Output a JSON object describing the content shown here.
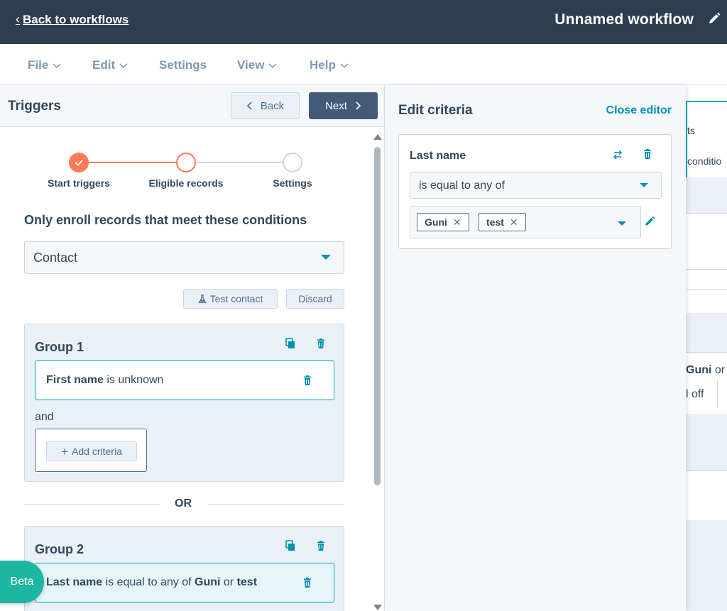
{
  "topbar": {
    "back_label": "Back to workflows",
    "title": "Unnamed workflow"
  },
  "menu": {
    "items": [
      {
        "label": "File",
        "has_caret": true
      },
      {
        "label": "Edit",
        "has_caret": true
      },
      {
        "label": "Settings",
        "has_caret": false
      },
      {
        "label": "View",
        "has_caret": true
      },
      {
        "label": "Help",
        "has_caret": true
      }
    ]
  },
  "triggers": {
    "title": "Triggers",
    "back_button": "Back",
    "next_button": "Next",
    "steps": [
      {
        "label": "Start triggers",
        "state": "complete"
      },
      {
        "label": "Eligible records",
        "state": "current"
      },
      {
        "label": "Settings",
        "state": "upcoming"
      }
    ],
    "section_heading": "Only enroll records that meet these conditions",
    "object_select": "Contact",
    "test_contact_button": "Test contact",
    "discard_button": "Discard",
    "groups": [
      {
        "title": "Group 1",
        "criteria": {
          "property": "First name",
          "rest": " is unknown"
        },
        "and_label": "and",
        "add_criteria": "Add criteria"
      },
      {
        "title": "Group 2",
        "criteria": {
          "property": "Last name",
          "middle": " is equal to any of ",
          "v1": "Guni",
          "joiner": " or ",
          "v2": "test"
        }
      }
    ],
    "or_label": "OR",
    "beta_badge": "Beta"
  },
  "editor": {
    "title": "Edit criteria",
    "close_label": "Close editor",
    "property": "Last name",
    "operator": "is equal to any of",
    "values": [
      "Guni",
      "test"
    ]
  },
  "background": {
    "text1": "ts",
    "text2": "conditio",
    "text3": "Guni",
    "text3b": "or",
    "text4": "l off"
  },
  "colors": {
    "topbar": "#2d3e50",
    "accent": "#0091ae",
    "orange": "#ff7a59",
    "teal_badge": "#1cb6a1",
    "group_bg": "#eaf0f6"
  }
}
